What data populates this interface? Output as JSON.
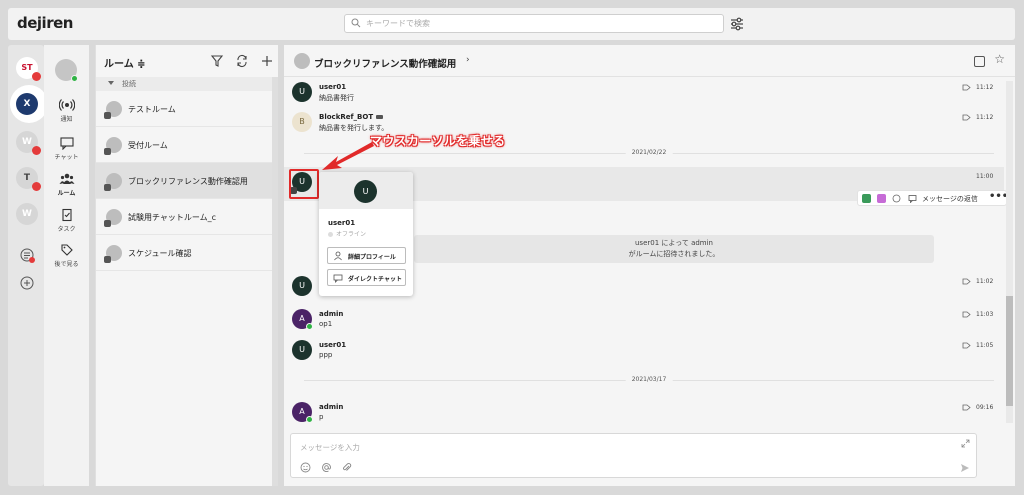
{
  "app": {
    "logo": "dejiren"
  },
  "search": {
    "placeholder": "キーワードで検索"
  },
  "workspaces": [
    {
      "label": "ST",
      "color": "#c8102e",
      "badge": ""
    },
    {
      "label": "X",
      "color": "#1e3a6e",
      "badge": ""
    },
    {
      "label": "W",
      "color": "#d6d6d6",
      "badge": ""
    },
    {
      "label": "T",
      "color": "#d6d6d6",
      "badge": ""
    },
    {
      "label": "W",
      "color": "#d6d6d6",
      "badge": ""
    }
  ],
  "nav": {
    "items": [
      {
        "label": "通知"
      },
      {
        "label": "チャット"
      },
      {
        "label": "ルーム"
      },
      {
        "label": "タスク"
      },
      {
        "label": "後で見る"
      }
    ]
  },
  "rooms": {
    "title": "ルーム ≑",
    "section": "投続",
    "items": [
      {
        "name": "テストルーム"
      },
      {
        "name": "受付ルーム"
      },
      {
        "name": "ブロックリファレンス動作確認用"
      },
      {
        "name": "試験用チャットルーム_c"
      },
      {
        "name": "スケジュール確認"
      }
    ]
  },
  "chat": {
    "title": "ブロックリファレンス動作確認用",
    "chevron": "›",
    "messages": [
      {
        "avatar": "U",
        "user": "user01",
        "text": "納品書発行",
        "time": "11:12"
      },
      {
        "avatar": "B",
        "user": "BlockRef_BOT",
        "text": "納品書を発行します。",
        "time": "11:12"
      },
      {
        "avatar": "U",
        "user": "",
        "text": "",
        "time": "11:00"
      },
      {
        "avatar": "U",
        "user": "",
        "text": "",
        "time": "11:02"
      },
      {
        "avatar": "A",
        "user": "admin",
        "text": "op1",
        "time": "11:03"
      },
      {
        "avatar": "U",
        "user": "user01",
        "text": "ppp",
        "time": "11:05"
      },
      {
        "avatar": "A",
        "user": "admin",
        "text": "p",
        "time": "09:16"
      }
    ],
    "dates": [
      "2021/02/22",
      "2021/03/17"
    ],
    "system": {
      "time": "11:02",
      "line1": "user01 によって admin",
      "line2": "がルームに招待されました。"
    },
    "hover_bar": {
      "label": "メッセージの返信",
      "more": "•••"
    },
    "input_placeholder": "メッセージを入力"
  },
  "popover": {
    "avatar": "U",
    "name": "user01",
    "status": "オフライン",
    "profile_button": "詳細プロフィール",
    "direct_button": "ダイレクトチャット"
  },
  "annotation": {
    "text": "マウスカーソルを乗せる"
  },
  "colors": {
    "annotation": "#e12a2a",
    "user_avatar": "#1c332d",
    "admin_avatar": "#4a2366",
    "online": "#2fb344"
  }
}
